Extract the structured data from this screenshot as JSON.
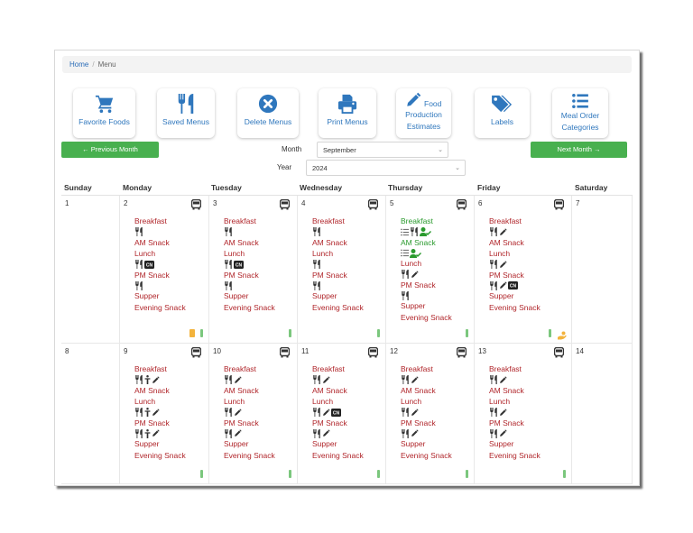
{
  "breadcrumb": {
    "home": "Home",
    "separator": "/",
    "current": "Menu"
  },
  "actions": [
    {
      "label": "Favorite Foods",
      "icon": "shopping-cart-icon"
    },
    {
      "label": "Saved Menus",
      "icon": "utensils-icon"
    },
    {
      "label": "Delete Menus",
      "icon": "times-circle-icon"
    },
    {
      "label": "Print Menus",
      "icon": "print-icon"
    },
    {
      "label_line1": "Food",
      "label_line2": "Production",
      "label_line3": "Estimates",
      "icon": "pencil-icon"
    },
    {
      "label": "Labels",
      "icon": "tags-icon"
    },
    {
      "label_line1": "Meal Order",
      "label_line2": "Categories",
      "icon": "list-icon"
    }
  ],
  "nav": {
    "prev": "← Previous Month",
    "next": "Next Month →"
  },
  "filters": {
    "month_label": "Month",
    "month_value": "September",
    "year_label": "Year",
    "year_value": "2024"
  },
  "colors": {
    "accent_blue": "#2f77bd",
    "button_green": "#48b04f",
    "meal_red": "#b0252a",
    "meal_green": "#2a9a2e"
  },
  "weekdays": [
    "Sunday",
    "Monday",
    "Tuesday",
    "Wednesday",
    "Thursday",
    "Friday",
    "Saturday"
  ],
  "weeks": [
    {
      "days": [
        {
          "num": "1"
        },
        {
          "num": "2",
          "bus": true,
          "meals": [
            {
              "name": "Breakfast",
              "icons": [
                "utensils"
              ]
            },
            {
              "name": "AM Snack",
              "icons": []
            },
            {
              "name": "Lunch",
              "icons": [
                "utensils",
                "cn-label"
              ]
            },
            {
              "name": "PM Snack",
              "icons": [
                "utensils"
              ]
            },
            {
              "name": "Supper",
              "icons": []
            },
            {
              "name": "Evening Snack",
              "icons": []
            }
          ],
          "footer": [
            "note",
            "battery"
          ]
        },
        {
          "num": "3",
          "bus": true,
          "meals": [
            {
              "name": "Breakfast",
              "icons": [
                "utensils"
              ]
            },
            {
              "name": "AM Snack",
              "icons": []
            },
            {
              "name": "Lunch",
              "icons": [
                "utensils",
                "cn-label"
              ]
            },
            {
              "name": "PM Snack",
              "icons": [
                "utensils"
              ]
            },
            {
              "name": "Supper",
              "icons": []
            },
            {
              "name": "Evening Snack",
              "icons": []
            }
          ],
          "footer": [
            "battery"
          ]
        },
        {
          "num": "4",
          "bus": true,
          "meals": [
            {
              "name": "Breakfast",
              "icons": [
                "utensils"
              ]
            },
            {
              "name": "AM Snack",
              "icons": []
            },
            {
              "name": "Lunch",
              "icons": [
                "utensils"
              ]
            },
            {
              "name": "PM Snack",
              "icons": [
                "utensils"
              ]
            },
            {
              "name": "Supper",
              "icons": []
            },
            {
              "name": "Evening Snack",
              "icons": []
            }
          ],
          "footer": [
            "battery"
          ]
        },
        {
          "num": "5",
          "bus": true,
          "meals": [
            {
              "name": "Breakfast",
              "green": true,
              "icons": [
                "list",
                "utensils",
                "user-check"
              ]
            },
            {
              "name": "AM Snack",
              "green": true,
              "icons": [
                "list",
                "user-check"
              ]
            },
            {
              "name": "Lunch",
              "icons": [
                "utensils",
                "pencil"
              ]
            },
            {
              "name": "PM Snack",
              "icons": [
                "utensils"
              ]
            },
            {
              "name": "Supper",
              "icons": []
            },
            {
              "name": "Evening Snack",
              "icons": []
            }
          ],
          "footer": [
            "battery"
          ]
        },
        {
          "num": "6",
          "bus": true,
          "meals": [
            {
              "name": "Breakfast",
              "icons": [
                "utensils",
                "pencil"
              ]
            },
            {
              "name": "AM Snack",
              "icons": []
            },
            {
              "name": "Lunch",
              "icons": [
                "utensils",
                "pencil"
              ]
            },
            {
              "name": "PM Snack",
              "icons": [
                "utensils",
                "pencil",
                "cn-label"
              ]
            },
            {
              "name": "Supper",
              "icons": []
            },
            {
              "name": "Evening Snack",
              "icons": []
            }
          ],
          "footer": [
            "battery",
            "hand-holding"
          ]
        },
        {
          "num": "7"
        }
      ]
    },
    {
      "days": [
        {
          "num": "8"
        },
        {
          "num": "9",
          "bus": true,
          "meals": [
            {
              "name": "Breakfast",
              "icons": [
                "utensils",
                "child",
                "pencil"
              ]
            },
            {
              "name": "AM Snack",
              "icons": []
            },
            {
              "name": "Lunch",
              "icons": [
                "utensils",
                "child",
                "pencil"
              ]
            },
            {
              "name": "PM Snack",
              "icons": [
                "utensils",
                "child",
                "pencil"
              ]
            },
            {
              "name": "Supper",
              "icons": []
            },
            {
              "name": "Evening Snack",
              "icons": []
            }
          ],
          "footer": [
            "battery"
          ]
        },
        {
          "num": "10",
          "bus": true,
          "meals": [
            {
              "name": "Breakfast",
              "icons": [
                "utensils",
                "pencil"
              ]
            },
            {
              "name": "AM Snack",
              "icons": []
            },
            {
              "name": "Lunch",
              "icons": [
                "utensils",
                "pencil"
              ]
            },
            {
              "name": "PM Snack",
              "icons": [
                "utensils",
                "pencil"
              ]
            },
            {
              "name": "Supper",
              "icons": []
            },
            {
              "name": "Evening Snack",
              "icons": []
            }
          ],
          "footer": [
            "battery"
          ]
        },
        {
          "num": "11",
          "bus": true,
          "meals": [
            {
              "name": "Breakfast",
              "icons": [
                "utensils",
                "pencil"
              ]
            },
            {
              "name": "AM Snack",
              "icons": []
            },
            {
              "name": "Lunch",
              "icons": [
                "utensils",
                "pencil",
                "cn-label"
              ]
            },
            {
              "name": "PM Snack",
              "icons": [
                "utensils",
                "pencil"
              ]
            },
            {
              "name": "Supper",
              "icons": []
            },
            {
              "name": "Evening Snack",
              "icons": []
            }
          ],
          "footer": [
            "battery"
          ]
        },
        {
          "num": "12",
          "bus": true,
          "meals": [
            {
              "name": "Breakfast",
              "icons": [
                "utensils",
                "pencil"
              ]
            },
            {
              "name": "AM Snack",
              "icons": []
            },
            {
              "name": "Lunch",
              "icons": [
                "utensils",
                "pencil"
              ]
            },
            {
              "name": "PM Snack",
              "icons": [
                "utensils",
                "pencil"
              ]
            },
            {
              "name": "Supper",
              "icons": []
            },
            {
              "name": "Evening Snack",
              "icons": []
            }
          ],
          "footer": [
            "battery"
          ]
        },
        {
          "num": "13",
          "bus": true,
          "meals": [
            {
              "name": "Breakfast",
              "icons": [
                "utensils",
                "pencil"
              ]
            },
            {
              "name": "AM Snack",
              "icons": []
            },
            {
              "name": "Lunch",
              "icons": [
                "utensils",
                "pencil"
              ]
            },
            {
              "name": "PM Snack",
              "icons": [
                "utensils",
                "pencil"
              ]
            },
            {
              "name": "Supper",
              "icons": []
            },
            {
              "name": "Evening Snack",
              "icons": []
            }
          ],
          "footer": [
            "battery"
          ]
        },
        {
          "num": "14"
        }
      ]
    }
  ]
}
